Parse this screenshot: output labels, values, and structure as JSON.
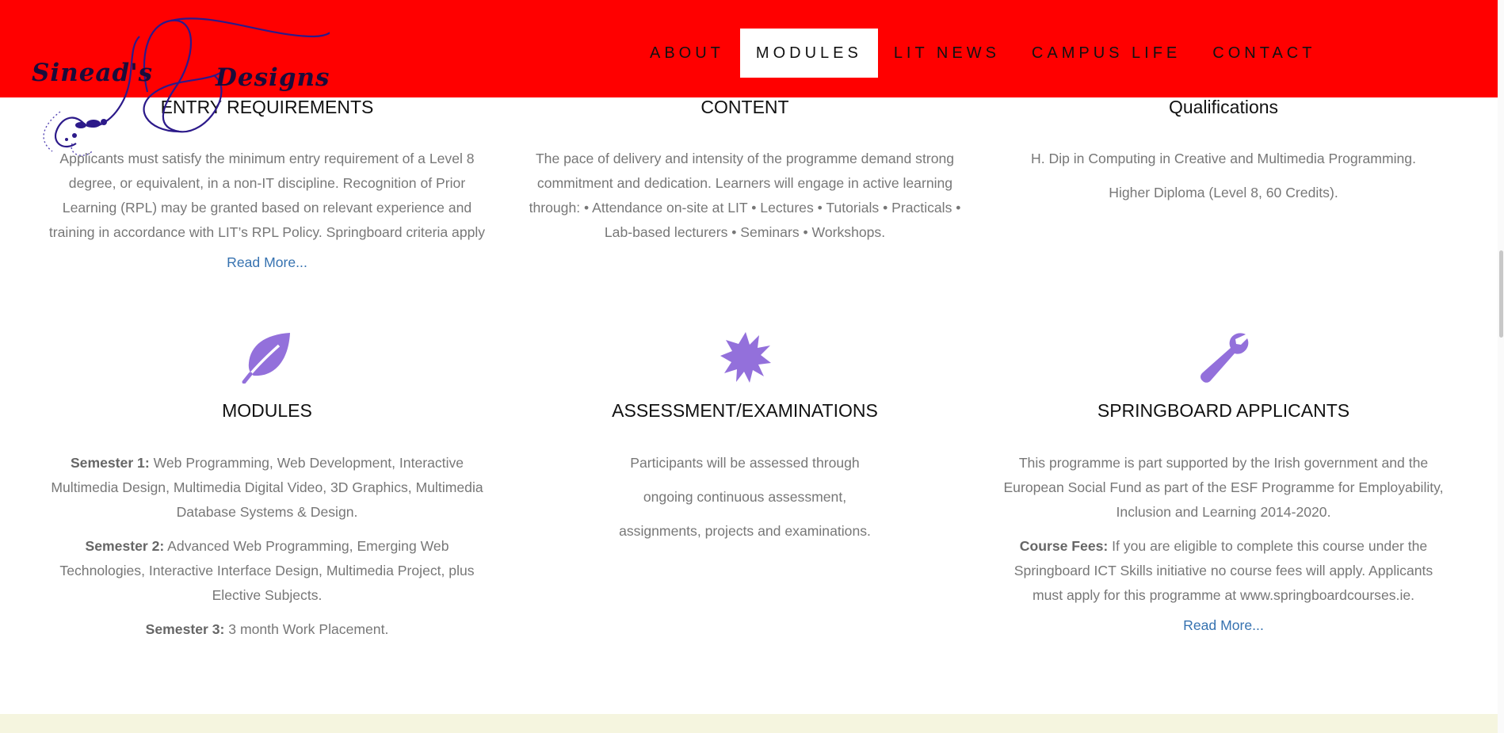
{
  "logo": {
    "text_left": "Sinead's",
    "text_right": "Designs"
  },
  "nav": {
    "items": [
      {
        "label": "ABOUT"
      },
      {
        "label": "MODULES"
      },
      {
        "label": "LIT NEWS"
      },
      {
        "label": "CAMPUS LIFE"
      },
      {
        "label": "CONTACT"
      }
    ],
    "active": "MODULES"
  },
  "colors": {
    "header_bg": "#ff0000",
    "icon_color": "#9370db",
    "link_color": "#3672b0",
    "footer_band": "#f5f5df"
  },
  "sections": {
    "entry": {
      "title": "ENTRY REQUIREMENTS",
      "text": "Applicants must satisfy the minimum entry requirement of a Level 8 degree, or equivalent, in a non-IT discipline. Recognition of Prior Learning (RPL) may be granted based on relevant experience and training in accordance with LIT’s RPL Policy. Springboard criteria apply",
      "link": "Read More..."
    },
    "content": {
      "title": "CONTENT",
      "text": "The pace of delivery and intensity of the programme demand strong commitment and dedication. Learners will engage in active learning through: • Attendance on-site at LIT • Lectures • Tutorials • Practicals • Lab-based lecturers • Seminars • Workshops."
    },
    "qualifications": {
      "title": "Qualifications",
      "line1": "H. Dip in Computing in Creative and Multimedia Programming.",
      "line2": "Higher Diploma (Level 8, 60 Credits)."
    },
    "modules": {
      "icon": "leaf-icon",
      "title": "MODULES",
      "s1_label": "Semester 1:",
      "s1_text": " Web Programming, Web Development, Interactive Multimedia Design, Multimedia Digital Video, 3D Graphics, Multimedia Database Systems & Design.",
      "s2_label": "Semester 2:",
      "s2_text": " Advanced Web Programming, Emerging Web Technologies, Interactive Interface Design, Multimedia Project, plus Elective Subjects.",
      "s3_label": "Semester 3:",
      "s3_text": " 3 month Work Placement."
    },
    "assessment": {
      "icon": "starburst-icon",
      "title": "ASSESSMENT/EXAMINATIONS",
      "line1": "Participants will be assessed through",
      "line2": "ongoing continuous assessment,",
      "line3": "assignments, projects and examinations."
    },
    "springboard": {
      "icon": "wrench-icon",
      "title": "SPRINGBOARD APPLICANTS",
      "text1": "This programme is part supported by the Irish government and the European Social Fund as part of the ESF Programme for Employability, Inclusion and Learning 2014-2020.",
      "fees_label": "Course Fees:",
      "fees_text": " If you are eligible to complete this course under the Springboard ICT Skills initiative no course fees will apply. Applicants must apply for this programme at www.springboardcourses.ie.",
      "link": "Read More..."
    }
  }
}
